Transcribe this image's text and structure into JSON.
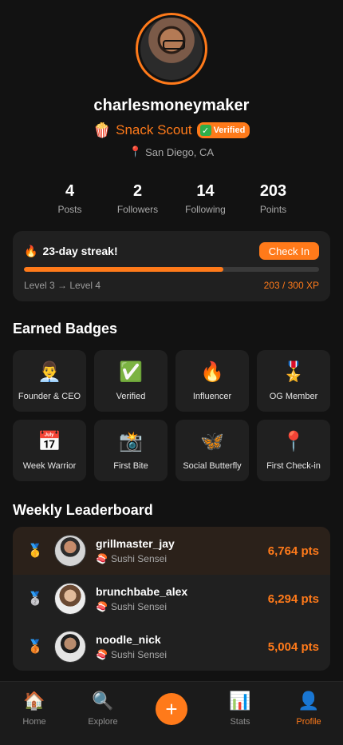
{
  "profile": {
    "username": "charlesmoneymaker",
    "rank_emoji": "🍿",
    "rank_title": "Snack Scout",
    "verified_icon": "✓",
    "verified_label": "Verified",
    "location_icon": "📍",
    "location": "San Diego, CA"
  },
  "stats": [
    {
      "value": "4",
      "label": "Posts"
    },
    {
      "value": "2",
      "label": "Followers"
    },
    {
      "value": "14",
      "label": "Following"
    },
    {
      "value": "203",
      "label": "Points"
    }
  ],
  "streak": {
    "icon": "🔥",
    "title": "23-day streak!",
    "checkin_label": "Check In",
    "level_text": "Level 3 → Level 4",
    "xp_text": "203 / 300 XP",
    "progress_fraction": 0.677
  },
  "badges": {
    "title": "Earned Badges",
    "items": [
      {
        "icon": "👨‍💼",
        "label": "Founder & CEO"
      },
      {
        "icon": "✅",
        "label": "Verified"
      },
      {
        "icon": "🔥",
        "label": "Influencer"
      },
      {
        "icon": "🎖️",
        "label": "OG Member"
      },
      {
        "icon": "📅",
        "label": "Week Warrior"
      },
      {
        "icon": "📸",
        "label": "First Bite"
      },
      {
        "icon": "🦋",
        "label": "Social Butterfly"
      },
      {
        "icon": "📍",
        "label": "First Check-in"
      }
    ]
  },
  "leaderboard": {
    "title": "Weekly Leaderboard",
    "rows": [
      {
        "medal": "🥇",
        "name": "grillmaster_jay",
        "sub_icon": "🍣",
        "sub": "Sushi Sensei",
        "points": "6,764 pts"
      },
      {
        "medal": "🥈",
        "name": "brunchbabe_alex",
        "sub_icon": "🍣",
        "sub": "Sushi Sensei",
        "points": "6,294 pts"
      },
      {
        "medal": "🥉",
        "name": "noodle_nick",
        "sub_icon": "🍣",
        "sub": "Sushi Sensei",
        "points": "5,004 pts"
      }
    ]
  },
  "nav": {
    "home": {
      "icon": "🏠",
      "label": "Home"
    },
    "explore": {
      "icon": "🔍",
      "label": "Explore"
    },
    "add": {
      "icon": "+"
    },
    "stats": {
      "icon": "📊",
      "label": "Stats"
    },
    "profile": {
      "icon": "👤",
      "label": "Profile"
    }
  },
  "colors": {
    "accent": "#ff7a1a",
    "background": "#121212",
    "card": "#202020"
  }
}
